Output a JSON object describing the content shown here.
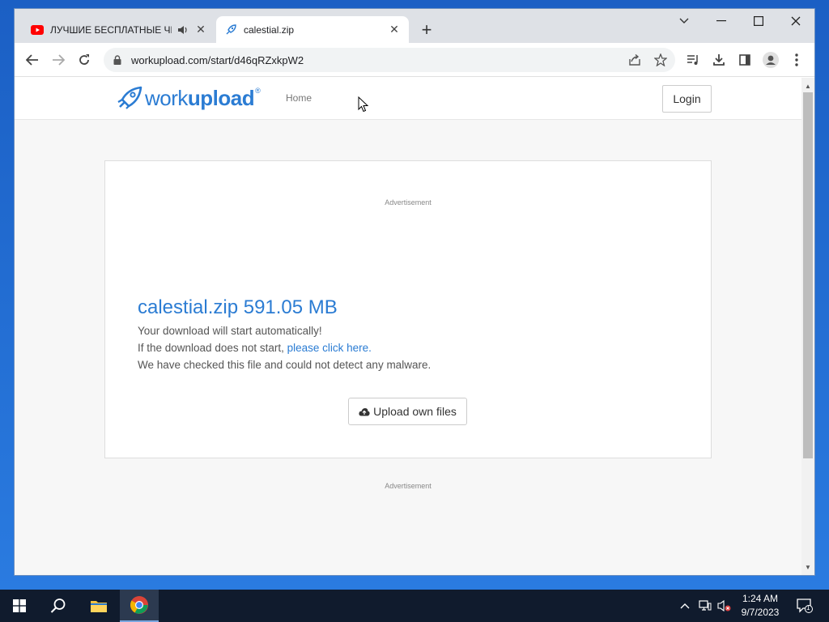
{
  "browser": {
    "tabs": [
      {
        "title": "ЛУЧШИЕ БЕСПЛАТНЫЕ ЧИТЫ",
        "favicon": "youtube-icon",
        "audio": "speaker-icon",
        "active": false
      },
      {
        "title": "calestial.zip",
        "favicon": "rocket-icon",
        "active": true
      }
    ],
    "url": "workupload.com/start/d46qRZxkpW2"
  },
  "site": {
    "logo_text_light": "work",
    "logo_text_bold": "upload",
    "logo_reg": "®",
    "nav_home": "Home",
    "login_label": "Login",
    "accent_color": "#2b7cd3"
  },
  "download": {
    "ad_top": "Advertisement",
    "file_title": "calestial.zip 591.05 MB",
    "line1": "Your download will start automatically!",
    "line2_prefix": "If the download does not start, ",
    "line2_link": "please click here.",
    "line3": "We have checked this file and could not detect any malware.",
    "upload_label": "Upload own files",
    "ad_bottom": "Advertisement"
  },
  "taskbar": {
    "time": "1:24 AM",
    "date": "9/7/2023",
    "notification_count": "1"
  }
}
